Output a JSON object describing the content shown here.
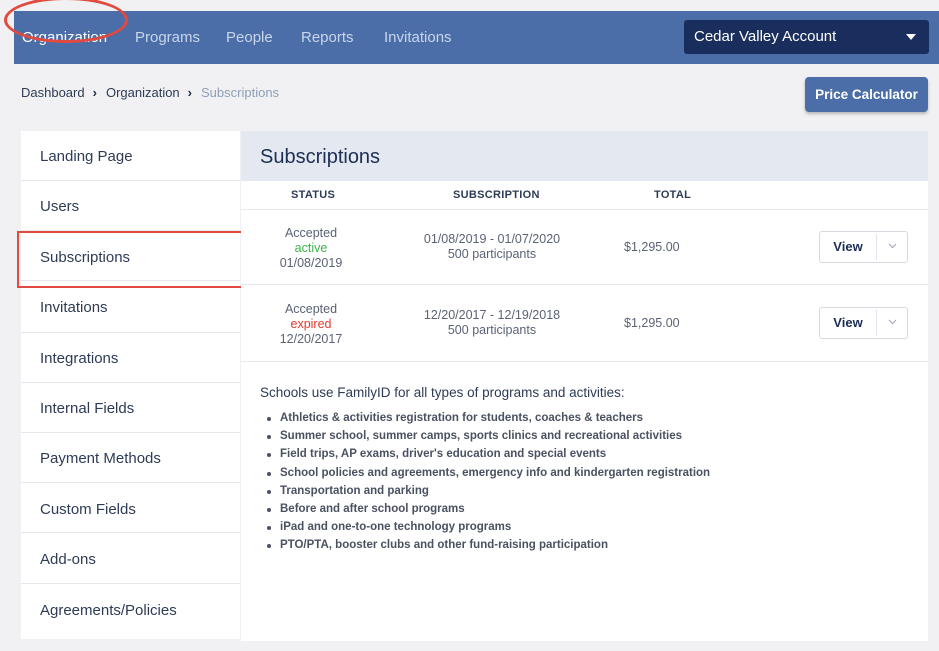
{
  "nav": {
    "items": [
      {
        "label": "Organization",
        "active": true
      },
      {
        "label": "Programs",
        "active": false
      },
      {
        "label": "People",
        "active": false
      },
      {
        "label": "Reports",
        "active": false
      },
      {
        "label": "Invitations",
        "active": false
      }
    ],
    "account": "Cedar Valley Account"
  },
  "breadcrumb": [
    "Dashboard",
    "Organization",
    "Subscriptions"
  ],
  "price_calculator_label": "Price Calculator",
  "sidebar": {
    "selected": "Subscriptions",
    "items": [
      {
        "label": "Landing Page"
      },
      {
        "label": "Users"
      },
      {
        "label": "Subscriptions"
      },
      {
        "label": "Invitations"
      },
      {
        "label": "Integrations"
      },
      {
        "label": "Internal Fields"
      },
      {
        "label": "Payment Methods"
      },
      {
        "label": "Custom Fields"
      },
      {
        "label": "Add-ons"
      },
      {
        "label": "Agreements/Policies"
      }
    ]
  },
  "main": {
    "title": "Subscriptions",
    "columns": [
      "STATUS",
      "SUBSCRIPTION",
      "TOTAL"
    ],
    "rows": [
      {
        "status": "Accepted",
        "state": "active",
        "date": "01/08/2019",
        "period": "01/08/2019 - 01/07/2020",
        "participants": "500 participants",
        "total": "$1,295.00",
        "action": "View"
      },
      {
        "status": "Accepted",
        "state": "expired",
        "date": "12/20/2017",
        "period": "12/20/2017 - 12/19/2018",
        "participants": "500 participants",
        "total": "$1,295.00",
        "action": "View"
      }
    ],
    "info_intro": "Schools use FamilyID for all types of programs and activities:",
    "info_items": [
      "Athletics & activities registration for students, coaches & teachers",
      "Summer school, summer camps, sports clinics and recreational activities",
      "Field trips, AP exams, driver's education and special events",
      "School policies and agreements, emergency info and kindergarten registration",
      "Transportation and parking",
      "Before and after school programs",
      "iPad and one-to-one technology programs",
      "PTO/PTA, booster clubs and other fund-raising participation"
    ]
  },
  "colors": {
    "nav_bg": "#4b6ea8",
    "account_bg": "#1a2e5e",
    "highlight_red": "#e04a3f",
    "active_green": "#3bb54a",
    "expired_red": "#e03a2f"
  }
}
